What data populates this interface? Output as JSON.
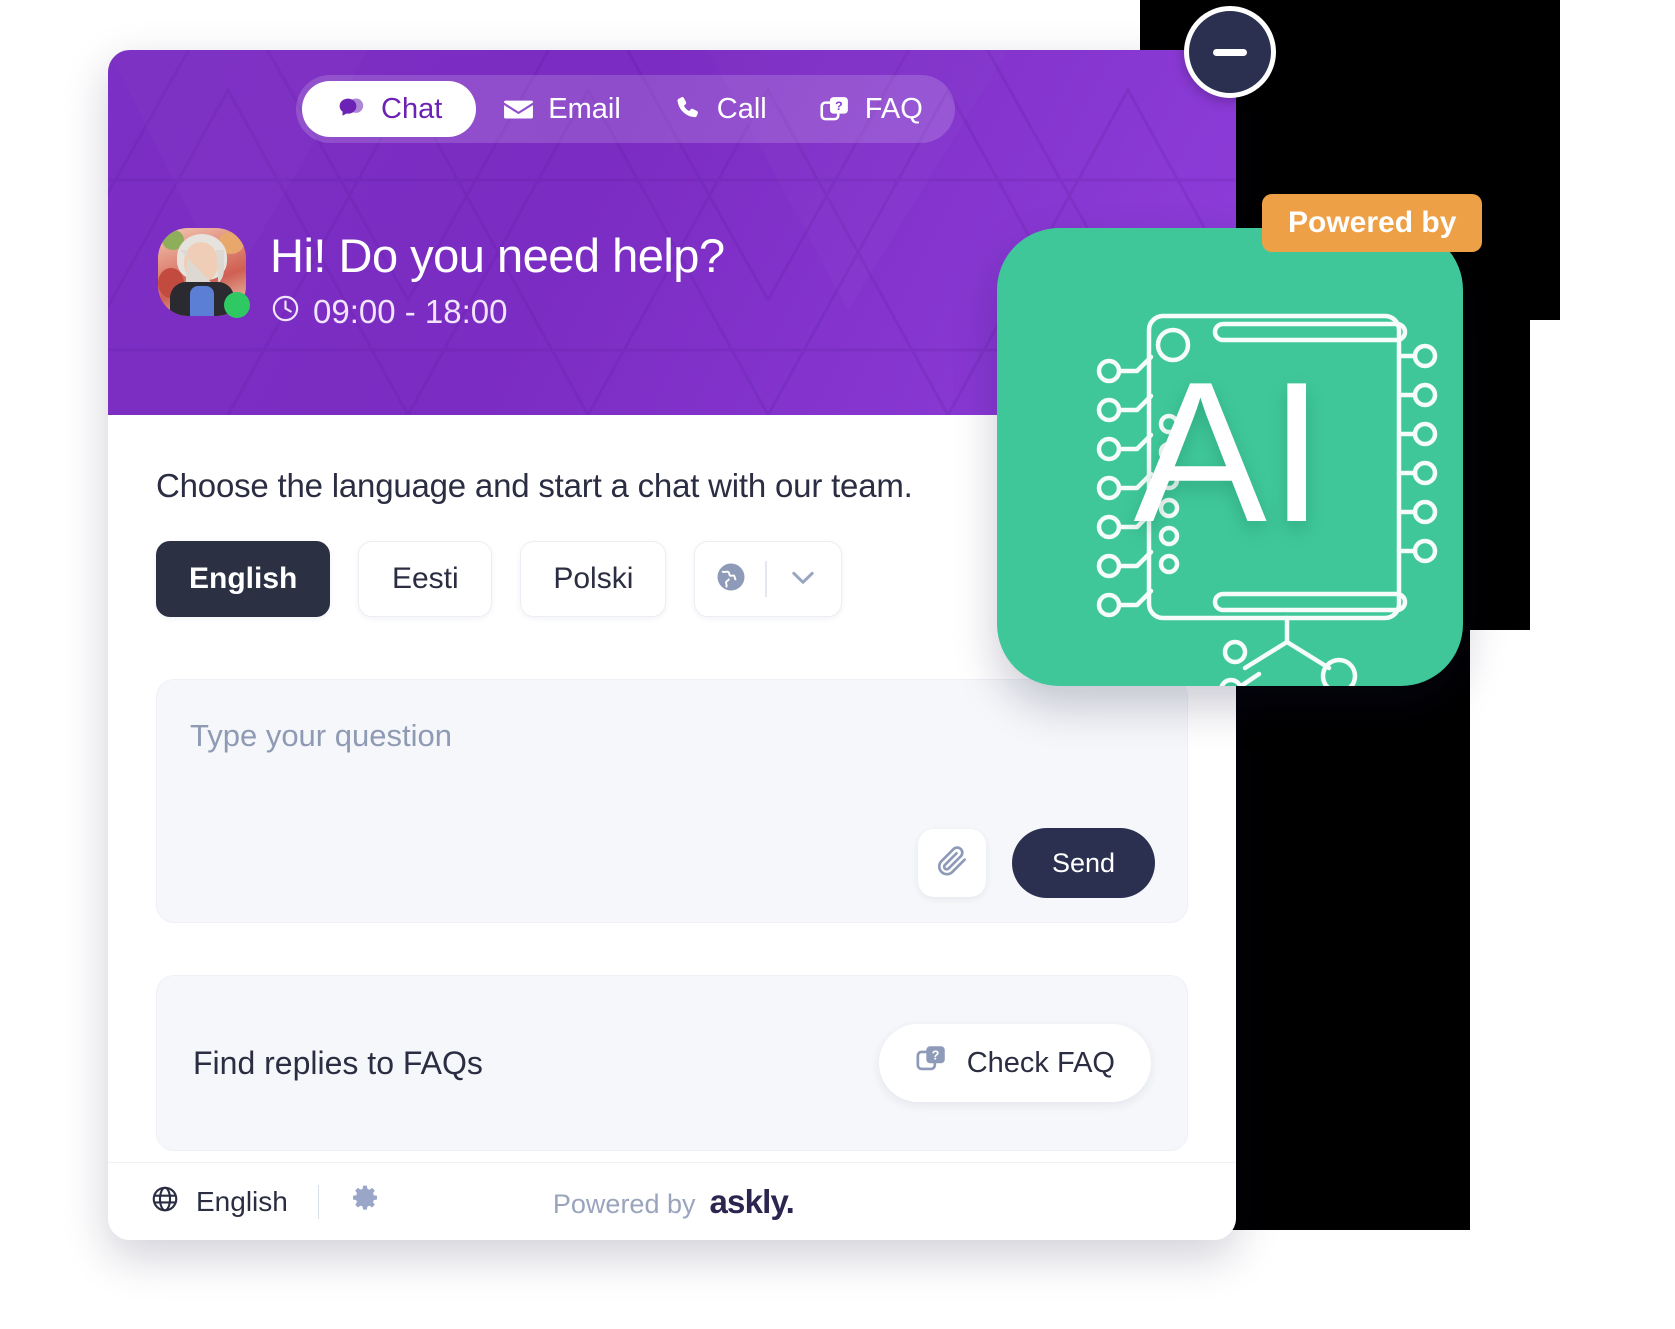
{
  "window": {
    "minimize_label": "minimize"
  },
  "header": {
    "tabs": [
      {
        "label": "Chat",
        "icon": "chat-bubble-icon",
        "active": true
      },
      {
        "label": "Email",
        "icon": "envelope-icon",
        "active": false
      },
      {
        "label": "Call",
        "icon": "phone-icon",
        "active": false
      },
      {
        "label": "FAQ",
        "icon": "faq-question-icon",
        "active": false
      }
    ],
    "greeting": "Hi! Do you need help?",
    "hours": "09:00 - 18:00",
    "clock_icon": "clock-icon",
    "status": "online",
    "colors": {
      "purple_start": "#7c2fc4",
      "purple_end": "#8e3ddb",
      "online_dot": "#2fc963"
    }
  },
  "main": {
    "choose_language_text": "Choose the language and start a chat with our team.",
    "languages": [
      {
        "label": "English",
        "active": true
      },
      {
        "label": "Eesti",
        "active": false
      },
      {
        "label": "Polski",
        "active": false
      }
    ],
    "more_languages": {
      "globe_icon": "globe-icon",
      "chevron_icon": "chevron-down-icon"
    },
    "composer": {
      "placeholder": "Type your question",
      "value": "",
      "attach_icon": "paperclip-icon",
      "send_label": "Send"
    },
    "faq": {
      "label": "Find replies to FAQs",
      "button_label": "Check FAQ",
      "button_icon": "faq-question-icon"
    }
  },
  "footer": {
    "globe_icon": "globe-icon",
    "language": "English",
    "settings_icon": "gear-icon",
    "powered_by": "Powered by",
    "brand": "askly."
  },
  "overlay": {
    "powered_badge": "Powered by",
    "ai_card": {
      "text": "AI",
      "icon": "ai-chip-icon",
      "color": "#3fc79a"
    },
    "badge_color": "#eda046"
  }
}
